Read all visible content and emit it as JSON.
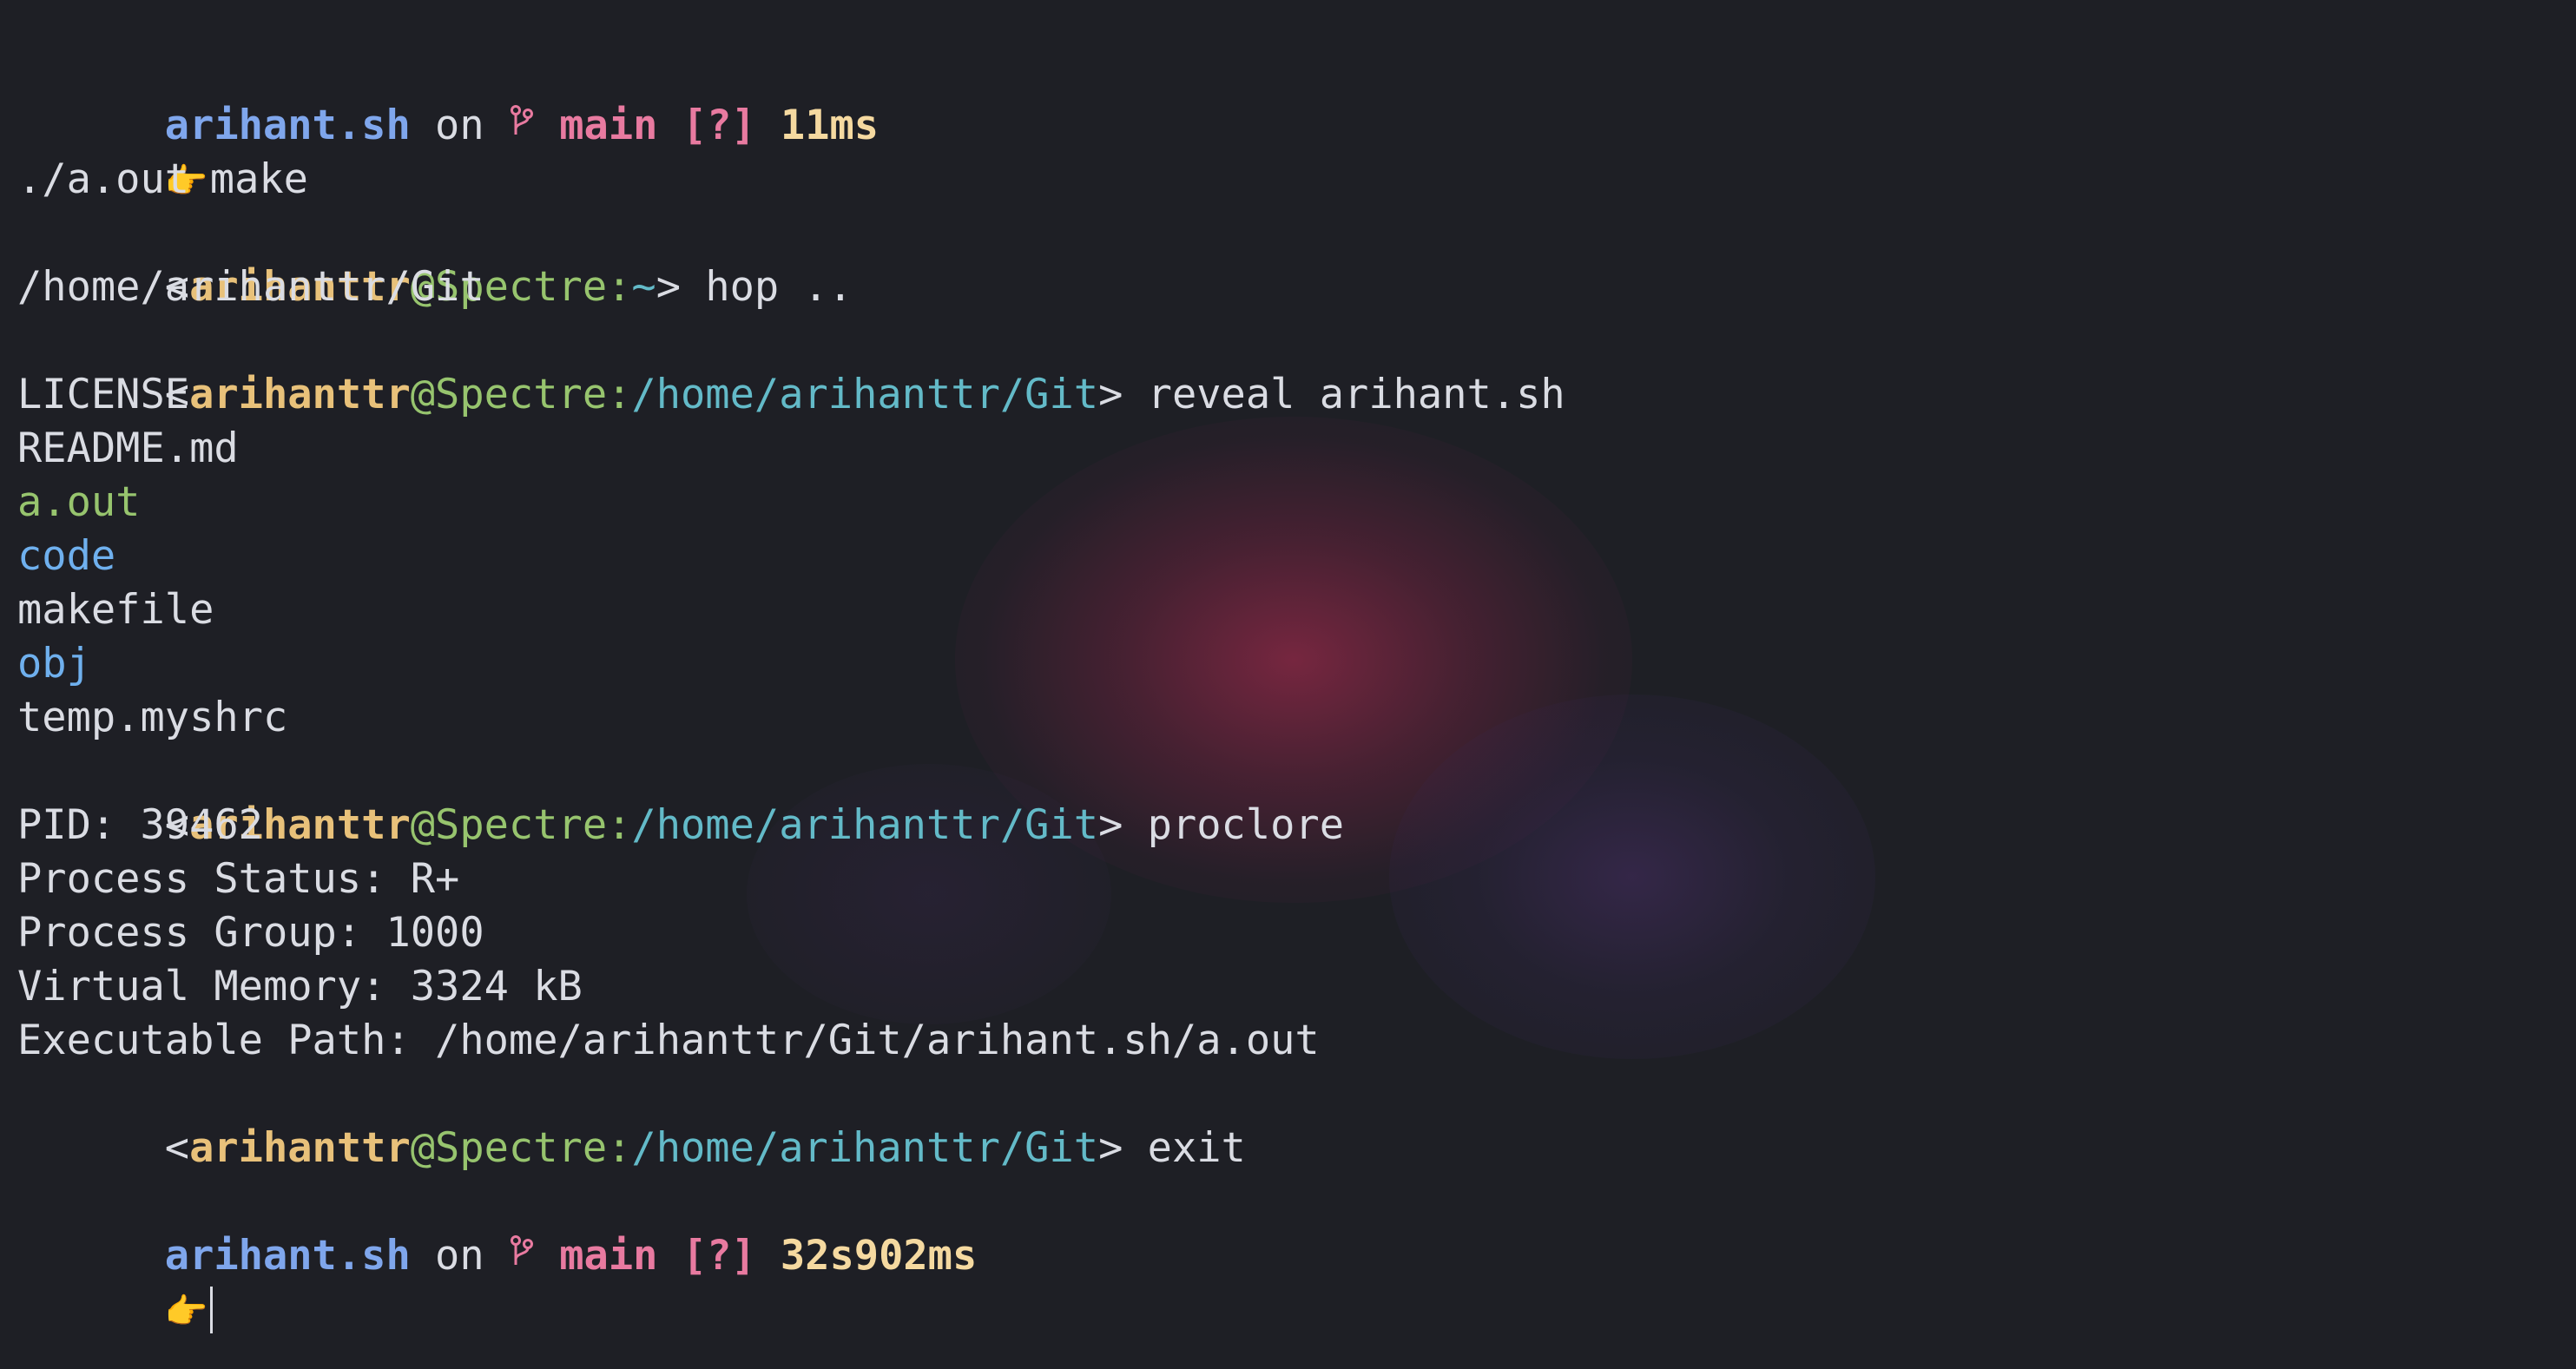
{
  "prompt_top": {
    "dir": "arihant.sh",
    "on": " on ",
    "branch": "main",
    "status": "[?]",
    "duration": "11ms"
  },
  "pointer_emoji": "👉",
  "cmd_make": "make",
  "out_aout": "./a.out",
  "shell_user": "arihanttr",
  "shell_host": "@Spectre:",
  "shell_home": "~",
  "shell_arrow": ">",
  "cmd_hop": "hop ..",
  "out_hop": "/home/arihanttr/Git",
  "shell_path": "/home/arihanttr/Git",
  "cmd_reveal": "reveal arihant.sh",
  "reveal_items": [
    {
      "name": "LICENSE",
      "kind": "file"
    },
    {
      "name": "README.md",
      "kind": "file"
    },
    {
      "name": "a.out",
      "kind": "executable"
    },
    {
      "name": "code",
      "kind": "folder"
    },
    {
      "name": "makefile",
      "kind": "file"
    },
    {
      "name": "obj",
      "kind": "folder"
    },
    {
      "name": "temp.myshrc",
      "kind": "file"
    }
  ],
  "cmd_proclore": "proclore",
  "proclore": {
    "pid": "PID: 39462",
    "status": "Process Status: R+",
    "group": "Process Group: 1000",
    "memory": "Virtual Memory: 3324 kB",
    "path": "Executable Path: /home/arihanttr/Git/arihant.sh/a.out"
  },
  "cmd_exit": "exit",
  "prompt_bottom": {
    "dir": "arihant.sh",
    "on": " on ",
    "branch": "main",
    "status": "[?]",
    "duration": "32s902ms"
  },
  "colors": {
    "background": "#1e1f25",
    "dir": "#7fa6ec",
    "branch": "#e87aa0",
    "duration": "#f5d9a0",
    "user": "#e8c17a",
    "host": "#97c46e",
    "path": "#63bac8",
    "executable": "#97c46e",
    "folder": "#6fb0ee"
  },
  "icons": {
    "branch": "git-branch-icon",
    "pointer": "pointing-hand-emoji"
  }
}
